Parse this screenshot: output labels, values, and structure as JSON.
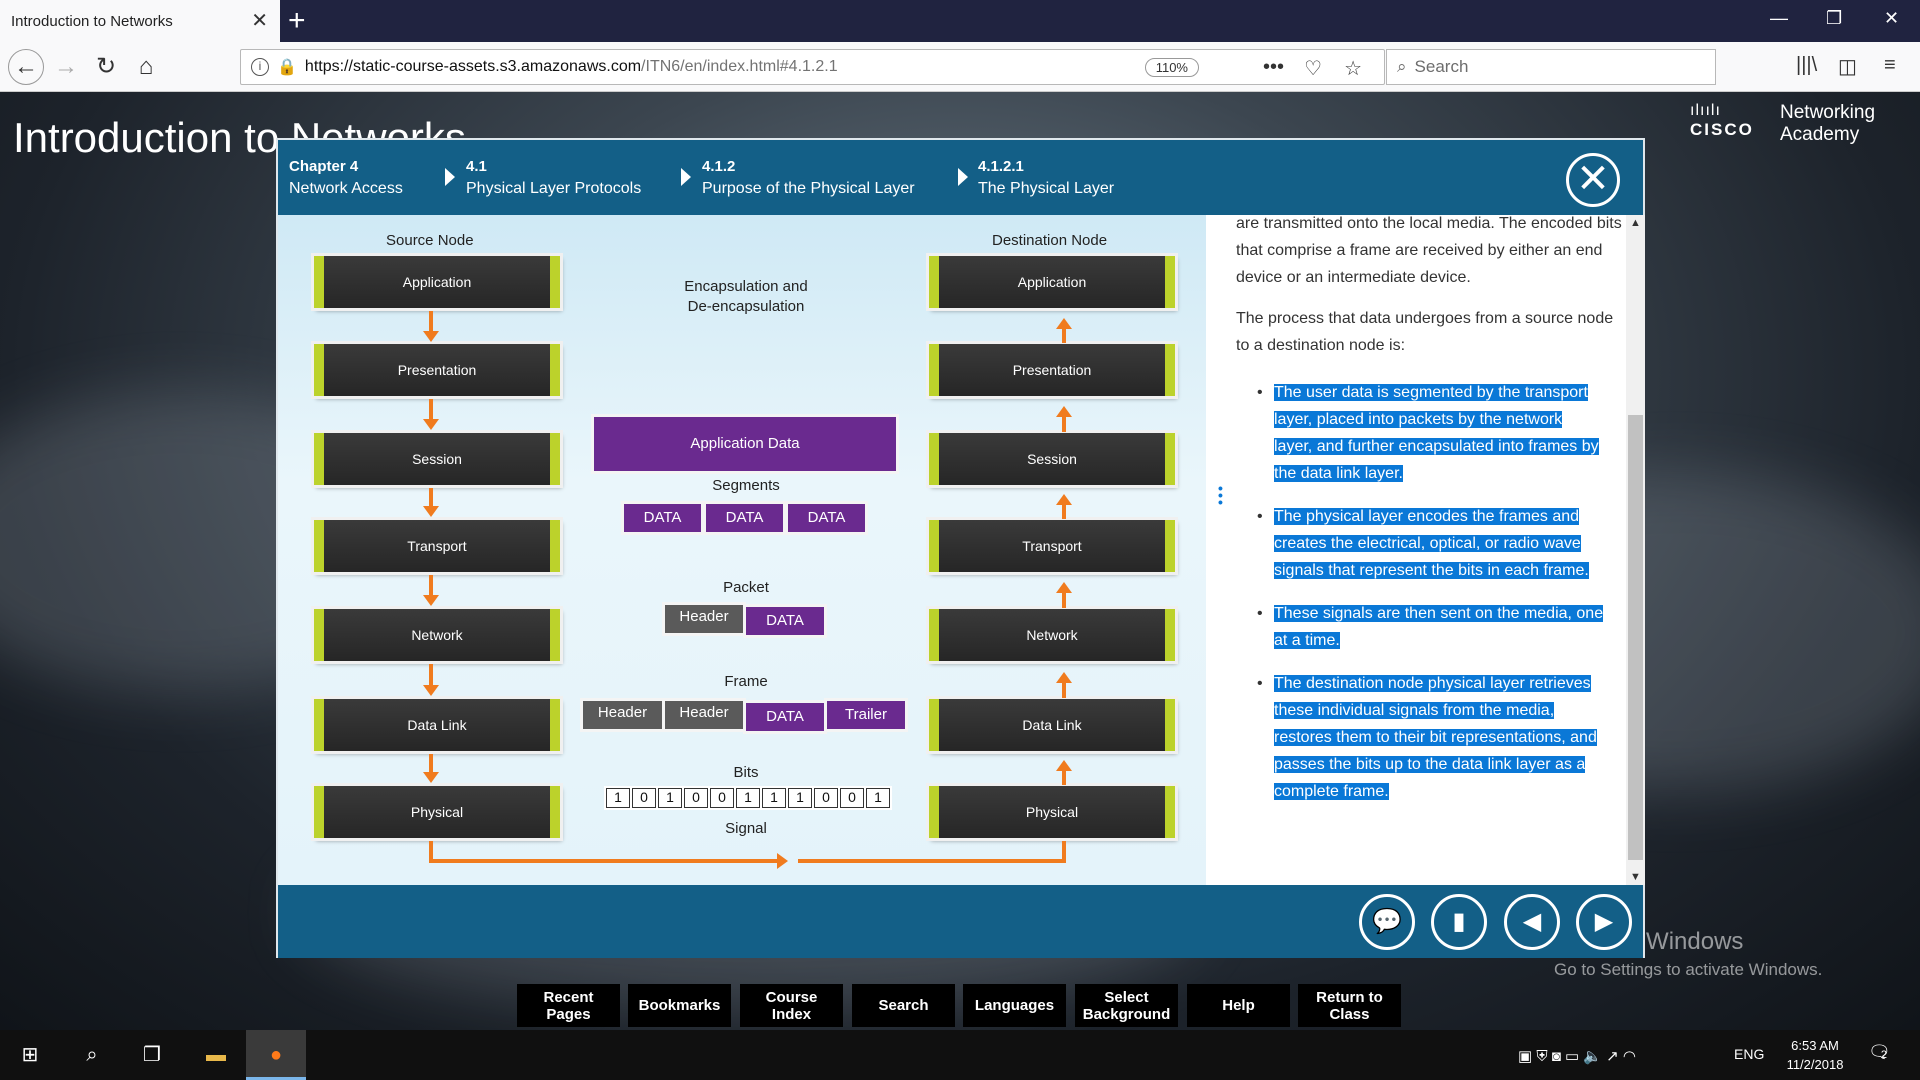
{
  "browser": {
    "tab_title": "Introduction to Networks",
    "url_host": "https://static-course-assets.s3.amazonaws.com",
    "url_path": "/ITN6/en/index.html#4.1.2.1",
    "zoom": "110%",
    "search_placeholder": "Search"
  },
  "page": {
    "title": "Introduction to Networks",
    "cisco_brand": "CISCO",
    "cisco_networking": "Networking",
    "cisco_academy": "Academy"
  },
  "modal": {
    "breadcrumb": [
      {
        "num": "Chapter 4",
        "label": "Network Access"
      },
      {
        "num": "4.1",
        "label": "Physical Layer Protocols"
      },
      {
        "num": "4.1.2",
        "label": "Purpose of the Physical Layer"
      },
      {
        "num": "4.1.2.1",
        "label": "The Physical Layer"
      }
    ]
  },
  "diagram": {
    "source_title": "Source Node",
    "dest_title": "Destination Node",
    "layers": [
      "Application",
      "Presentation",
      "Session",
      "Transport",
      "Network",
      "Data Link",
      "Physical"
    ],
    "encap_title_1": "Encapsulation and",
    "encap_title_2": "De-encapsulation",
    "app_data": "Application Data",
    "segments_label": "Segments",
    "segments": [
      "DATA",
      "DATA",
      "DATA"
    ],
    "packet_label": "Packet",
    "packet_header": "Header",
    "packet_data": "DATA",
    "frame_label": "Frame",
    "frame_header1": "Header",
    "frame_header2": "Header",
    "frame_data": "DATA",
    "frame_trailer": "Trailer",
    "bits_label": "Bits",
    "bits": [
      "1",
      "0",
      "1",
      "0",
      "0",
      "1",
      "1",
      "1",
      "0",
      "0",
      "1"
    ],
    "signal_label": "Signal"
  },
  "text": {
    "p1": "are transmitted onto the local media. The encoded bits that comprise a frame are received by either an end device or an intermediate device.",
    "p2": "The process that data undergoes from a source node to a destination node is:",
    "bullets": [
      "The user data is segmented by the transport layer, placed into packets by the network layer, and further encapsulated into frames by the data link layer.",
      "The physical layer encodes the frames and creates the electrical, optical, or radio wave signals that represent the bits in each frame.",
      "These signals are then sent on the media, one at a time.",
      "The destination node physical layer retrieves these individual signals from the media, restores them to their bit representations, and passes the bits up to the data link layer as a complete frame."
    ]
  },
  "watermark": {
    "line1": "Activate Windows",
    "line2": "Go to Settings to activate Windows."
  },
  "bottom_toolbar": {
    "recent_1": "Recent",
    "recent_2": "Pages",
    "bookmarks": "Bookmarks",
    "index_1": "Course",
    "index_2": "Index",
    "search": "Search",
    "languages": "Languages",
    "bg_1": "Select",
    "bg_2": "Background",
    "help": "Help",
    "return_1": "Return to",
    "return_2": "Class"
  },
  "taskbar": {
    "language": "ENG",
    "time": "6:53 AM",
    "date": "11/2/2018",
    "notification_count": "2"
  }
}
